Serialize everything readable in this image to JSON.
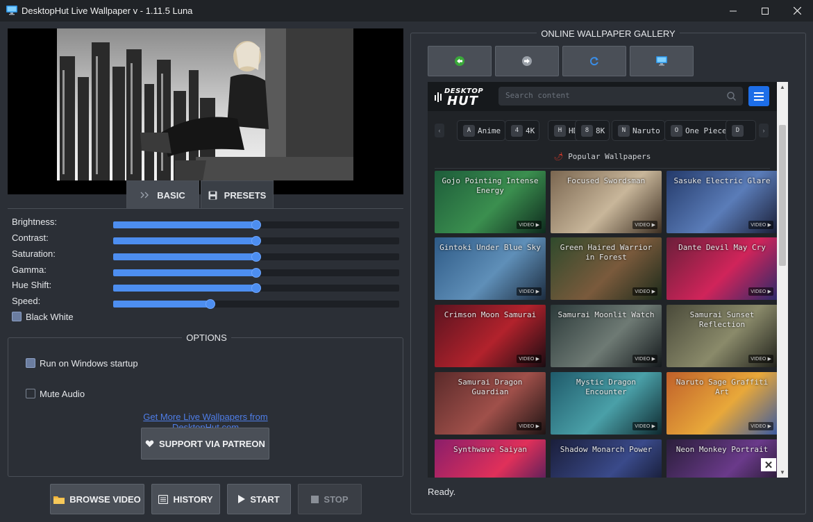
{
  "window": {
    "title": "DesktopHut Live Wallpaper v - 1.11.5 Luna",
    "controls": [
      "minimize",
      "maximize",
      "close"
    ]
  },
  "tabs": [
    {
      "label": "BASIC",
      "icon": "chevrons-icon"
    },
    {
      "label": "PRESETS",
      "icon": "floppy-icon"
    }
  ],
  "sliders": [
    {
      "label": "Brightness:",
      "value": 0.5
    },
    {
      "label": "Contrast:",
      "value": 0.5
    },
    {
      "label": "Saturation:",
      "value": 0.5
    },
    {
      "label": "Gamma:",
      "value": 0.5
    },
    {
      "label": "Hue Shift:",
      "value": 0.5
    },
    {
      "label": "Speed:",
      "value": 0.34
    }
  ],
  "black_white": {
    "label": "Black  White",
    "checked": true
  },
  "options": {
    "title": "OPTIONS",
    "run_on_startup": {
      "label": "Run on Windows startup",
      "checked": true
    },
    "mute_audio": {
      "label": "Mute Audio",
      "checked": false
    },
    "link": "Get More Live Wallpapers from DesktopHut.com",
    "patreon_button": "SUPPORT VIA PATREON"
  },
  "bottom_buttons": {
    "browse": "BROWSE VIDEO",
    "history": "HISTORY",
    "start": "START",
    "stop": "STOP"
  },
  "gallery": {
    "title": "ONLINE WALLPAPER GALLERY",
    "nav": [
      "back-icon",
      "forward-icon",
      "refresh-icon",
      "monitor-icon"
    ],
    "web": {
      "logo_top": "DESKTOP",
      "logo_bottom": "HUT",
      "search_placeholder": "Search content",
      "chips": [
        {
          "badge": "A",
          "label": "Anime"
        },
        {
          "badge": "4",
          "label": "4K"
        },
        {
          "badge": "H",
          "label": "HD"
        },
        {
          "badge": "8",
          "label": "8K"
        },
        {
          "badge": "N",
          "label": "Naruto"
        },
        {
          "badge": "O",
          "label": "One Piece"
        },
        {
          "badge": "D",
          "label": ""
        }
      ],
      "popular_heading": "Popular Wallpapers",
      "badge_text": "VIDEO ▶",
      "cards": [
        {
          "title": "Gojo Pointing Intense Energy",
          "colors": [
            "#1d5c3a",
            "#3b8f4f",
            "#0e2a1d"
          ]
        },
        {
          "title": "Focused Swordsman",
          "colors": [
            "#7a6650",
            "#c8b69a",
            "#3d2f22"
          ]
        },
        {
          "title": "Sasuke Electric Glare",
          "colors": [
            "#243a6a",
            "#5a7cb8",
            "#1a1e36"
          ]
        },
        {
          "title": "Gintoki Under Blue Sky",
          "colors": [
            "#2e5a86",
            "#5f8fb8",
            "#1c2c3f"
          ]
        },
        {
          "title": "Green Haired Warrior in Forest",
          "colors": [
            "#2f4a2c",
            "#7a5a3c",
            "#1b2a1a"
          ]
        },
        {
          "title": "Dante Devil May Cry",
          "colors": [
            "#6a1f3a",
            "#d0245a",
            "#2a2a6a"
          ]
        },
        {
          "title": "Crimson Moon Samurai",
          "colors": [
            "#5a1420",
            "#b2222c",
            "#1a0c12"
          ]
        },
        {
          "title": "Samurai Moonlit Watch",
          "colors": [
            "#2c3a3a",
            "#6e7a74",
            "#14191c"
          ]
        },
        {
          "title": "Samurai Sunset Reflection",
          "colors": [
            "#4a4a3a",
            "#8a8a6a",
            "#1f201a"
          ]
        },
        {
          "title": "Samurai Dragon Guardian",
          "colors": [
            "#5a2a2a",
            "#a0504a",
            "#1e1414"
          ]
        },
        {
          "title": "Mystic Dragon Encounter",
          "colors": [
            "#1f5a6a",
            "#4aa0a8",
            "#0f2a30"
          ]
        },
        {
          "title": "Naruto Sage Graffiti Art",
          "colors": [
            "#c0602a",
            "#e8a83a",
            "#3a5aa0"
          ]
        },
        {
          "title": "Synthwave Saiyan",
          "colors": [
            "#8a1e6a",
            "#e0305a",
            "#2a1a5a"
          ]
        },
        {
          "title": "Shadow Monarch Power",
          "colors": [
            "#1a1e3a",
            "#3a4a8a",
            "#0c0e1c"
          ]
        },
        {
          "title": "Neon Monkey Portrait",
          "colors": [
            "#2a1e3a",
            "#6a3a8a",
            "#141018"
          ]
        }
      ]
    }
  },
  "status": "Ready."
}
